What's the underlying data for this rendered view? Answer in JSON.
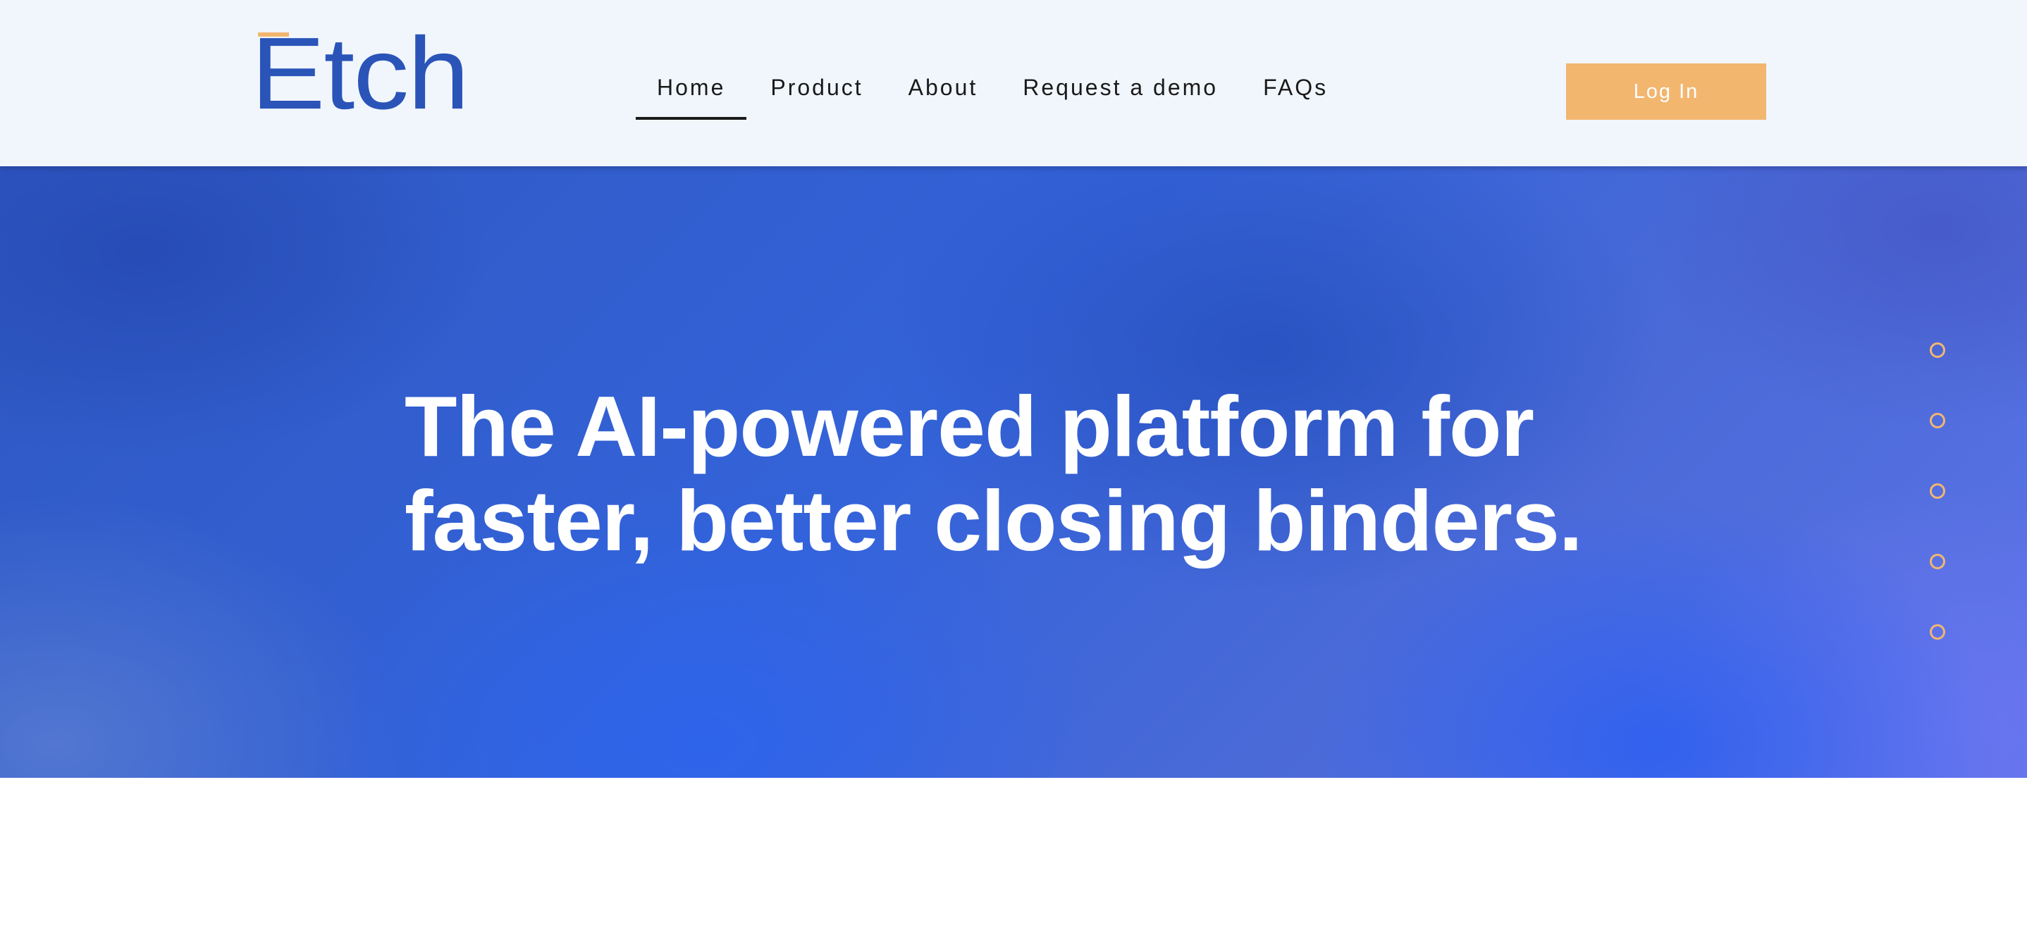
{
  "header": {
    "logo_text": "Etch",
    "nav": [
      {
        "label": "Home",
        "active": true
      },
      {
        "label": "Product",
        "active": false
      },
      {
        "label": "About",
        "active": false
      },
      {
        "label": "Request a demo",
        "active": false
      },
      {
        "label": "FAQs",
        "active": false
      }
    ],
    "login_label": "Log In"
  },
  "hero": {
    "headline_line1": "The AI-powered platform for",
    "headline_line2": "faster, better closing binders.",
    "section_dots": 5
  },
  "colors": {
    "brand_blue": "#2a54b8",
    "accent_orange": "#f2b66f",
    "header_bg": "#f1f6fd",
    "hero_blue": "#3463d9"
  }
}
